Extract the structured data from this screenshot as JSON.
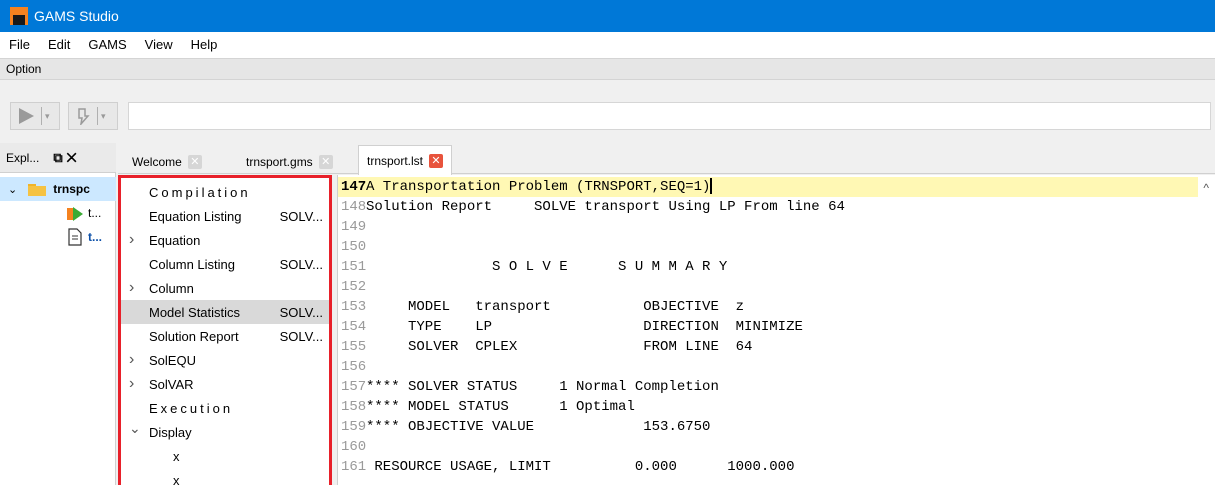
{
  "window": {
    "title": "GAMS Studio"
  },
  "menu": [
    "File",
    "Edit",
    "GAMS",
    "View",
    "Help"
  ],
  "option_bar": {
    "label": "Option"
  },
  "explorer": {
    "title": "Expl...",
    "items": [
      {
        "label": "trnspc",
        "type": "project"
      },
      {
        "label": "t...",
        "type": "gms"
      },
      {
        "label": "t...",
        "type": "lst"
      }
    ]
  },
  "tabs": [
    {
      "label": "Welcome"
    },
    {
      "label": "trnsport.gms"
    },
    {
      "label": "trnsport.lst"
    }
  ],
  "nav": [
    {
      "kind": "section",
      "label": "Compilation",
      "arrow": ""
    },
    {
      "kind": "item",
      "label": "Equation Listing",
      "value": "SOLV...",
      "arrow": ""
    },
    {
      "kind": "item",
      "label": "Equation",
      "value": "",
      "arrow": ">"
    },
    {
      "kind": "item",
      "label": "Column Listing",
      "value": "SOLV...",
      "arrow": ""
    },
    {
      "kind": "item",
      "label": "Column",
      "value": "",
      "arrow": ">"
    },
    {
      "kind": "item",
      "label": "Model Statistics",
      "value": "SOLV...",
      "arrow": "",
      "highlight": true
    },
    {
      "kind": "item",
      "label": "Solution Report",
      "value": "SOLV...",
      "arrow": ""
    },
    {
      "kind": "item",
      "label": "SolEQU",
      "value": "",
      "arrow": ">"
    },
    {
      "kind": "item",
      "label": "SolVAR",
      "value": "",
      "arrow": ">"
    },
    {
      "kind": "section",
      "label": "Execution",
      "arrow": ""
    },
    {
      "kind": "item",
      "label": "Display",
      "value": "",
      "arrow": "v"
    },
    {
      "kind": "child",
      "label": "x",
      "value": "",
      "arrow": ""
    },
    {
      "kind": "child",
      "label": "x",
      "value": "",
      "arrow": ""
    }
  ],
  "editor": {
    "lines": [
      {
        "n": "147",
        "text": "A Transportation Problem (TRNSPORT,SEQ=1)",
        "current": true
      },
      {
        "n": "148",
        "text": "Solution Report     SOLVE transport Using LP From line 64"
      },
      {
        "n": "149",
        "text": ""
      },
      {
        "n": "150",
        "text": ""
      },
      {
        "n": "151",
        "text": "               S O L V E      S U M M A R Y"
      },
      {
        "n": "152",
        "text": ""
      },
      {
        "n": "153",
        "text": "     MODEL   transport           OBJECTIVE  z"
      },
      {
        "n": "154",
        "text": "     TYPE    LP                  DIRECTION  MINIMIZE"
      },
      {
        "n": "155",
        "text": "     SOLVER  CPLEX               FROM LINE  64"
      },
      {
        "n": "156",
        "text": ""
      },
      {
        "n": "157",
        "text": "**** SOLVER STATUS     1 Normal Completion"
      },
      {
        "n": "158",
        "text": "**** MODEL STATUS      1 Optimal"
      },
      {
        "n": "159",
        "text": "**** OBJECTIVE VALUE             153.6750"
      },
      {
        "n": "160",
        "text": ""
      },
      {
        "n": "161",
        "text": " RESOURCE USAGE, LIMIT          0.000      1000.000"
      }
    ]
  }
}
